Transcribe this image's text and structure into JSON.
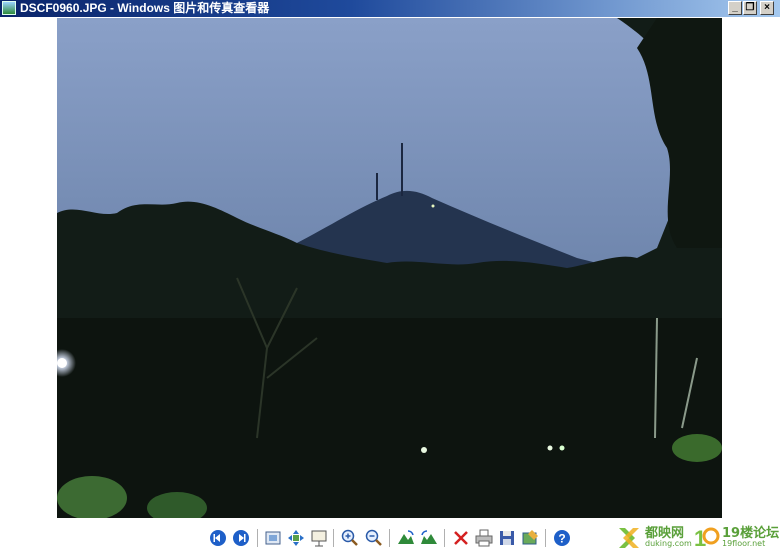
{
  "window": {
    "title": "DSCF0960.JPG - Windows 图片和传真查看器",
    "controls": [
      "minimize",
      "restore",
      "close"
    ]
  },
  "photo": {
    "file": "DSCF0960.JPG",
    "description_icon": "image-photo",
    "colors": {
      "sky": "#6f86ad",
      "mountain": "#1e2d45",
      "trees": "#0f1711"
    }
  },
  "toolbar": {
    "buttons": [
      {
        "icon": "previous-image-icon"
      },
      {
        "icon": "next-image-icon"
      },
      {
        "icon": "best-fit-icon"
      },
      {
        "icon": "actual-size-icon"
      },
      {
        "icon": "slideshow-icon"
      },
      {
        "icon": "zoom-in-icon"
      },
      {
        "icon": "zoom-out-icon"
      },
      {
        "icon": "rotate-clockwise-icon"
      },
      {
        "icon": "rotate-counterclockwise-icon"
      },
      {
        "icon": "delete-icon"
      },
      {
        "icon": "print-icon"
      },
      {
        "icon": "save-icon"
      },
      {
        "icon": "edit-icon"
      },
      {
        "icon": "help-icon"
      }
    ]
  },
  "watermarks": {
    "left": {
      "main": "都映网",
      "sub": "duking.com"
    },
    "right": {
      "main": "19楼论坛",
      "sub": "19floor.net"
    }
  }
}
